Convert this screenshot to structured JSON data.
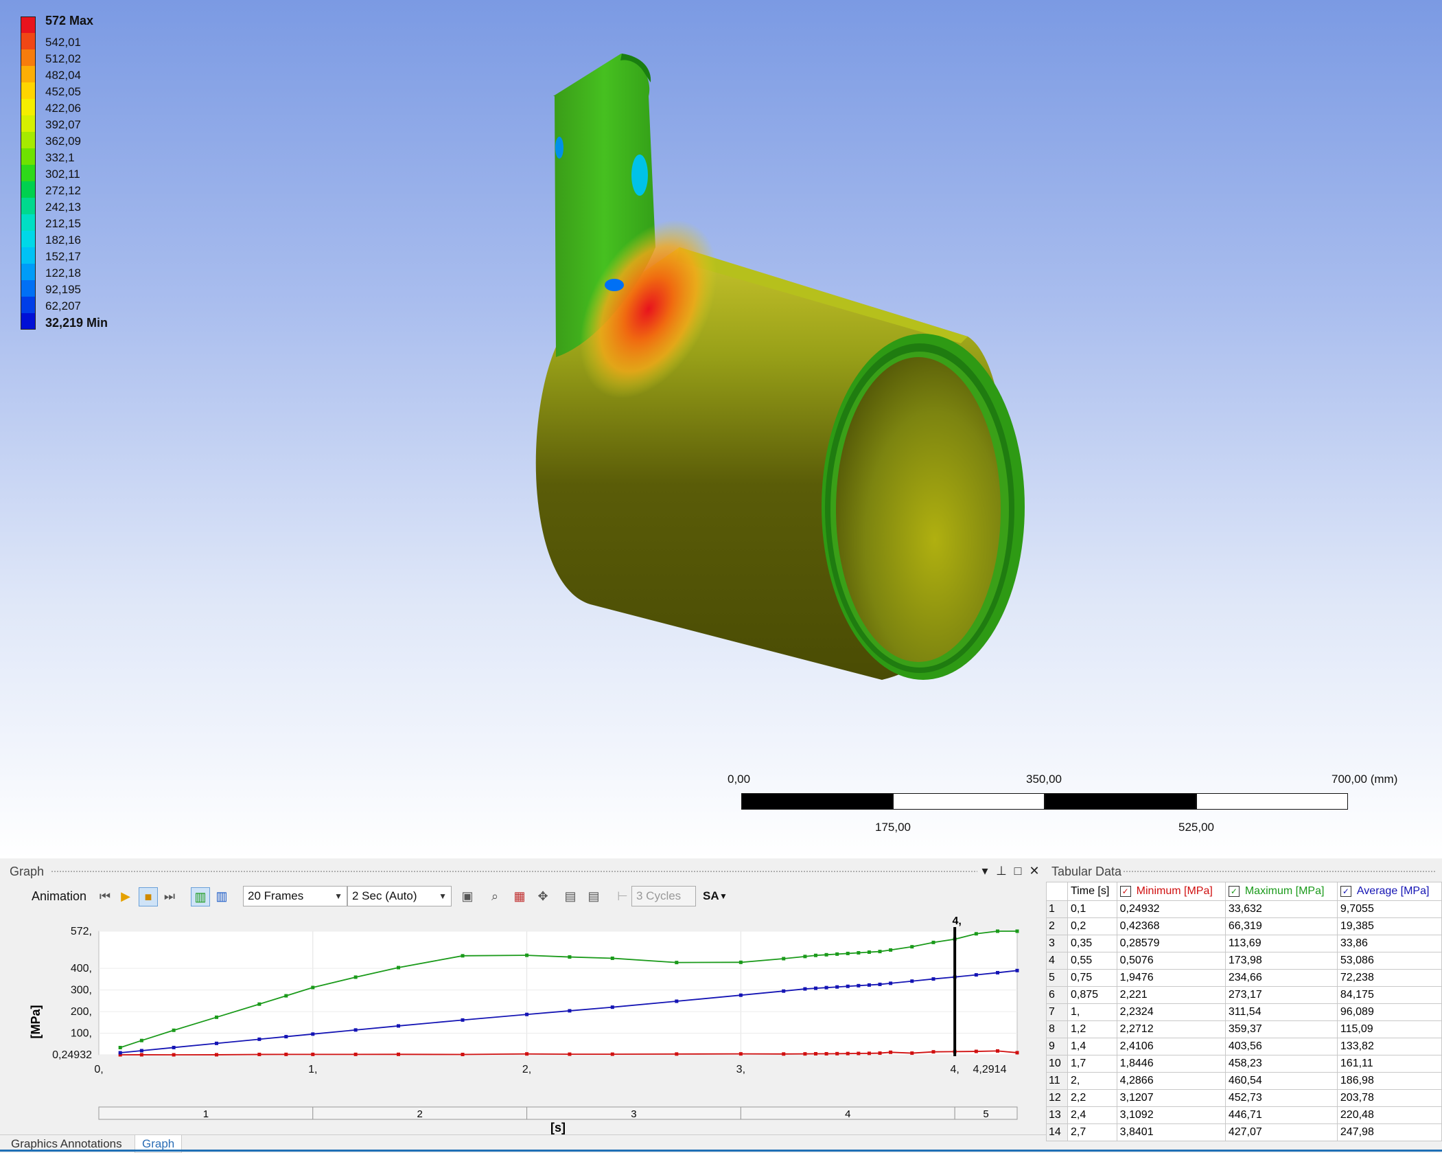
{
  "legend": {
    "entries": [
      {
        "label": "572 Max",
        "color": "#e8131d",
        "bold": true
      },
      {
        "label": "542,01",
        "color": "#f04715"
      },
      {
        "label": "512,02",
        "color": "#f77c0c"
      },
      {
        "label": "482,04",
        "color": "#fcae06"
      },
      {
        "label": "452,05",
        "color": "#ffd500"
      },
      {
        "label": "422,06",
        "color": "#f5ee00"
      },
      {
        "label": "392,07",
        "color": "#d6f000"
      },
      {
        "label": "362,09",
        "color": "#a6ea00"
      },
      {
        "label": "332,1",
        "color": "#6ee200"
      },
      {
        "label": "302,11",
        "color": "#2ed91a"
      },
      {
        "label": "272,12",
        "color": "#00d14f"
      },
      {
        "label": "242,13",
        "color": "#00d98e"
      },
      {
        "label": "212,15",
        "color": "#00dfc4"
      },
      {
        "label": "182,16",
        "color": "#00d8e8"
      },
      {
        "label": "152,17",
        "color": "#00c2f5"
      },
      {
        "label": "122,18",
        "color": "#009cf8"
      },
      {
        "label": "92,195",
        "color": "#0070f5"
      },
      {
        "label": "62,207",
        "color": "#003ee8"
      },
      {
        "label": "32,219 Min",
        "color": "#0010d6",
        "bold": true
      }
    ]
  },
  "scale_bar": {
    "top_labels": [
      "0,00",
      "350,00",
      "700,00 (mm)"
    ],
    "bottom_labels": [
      "175,00",
      "525,00"
    ]
  },
  "graph_panel": {
    "title": "Graph",
    "toolbar": {
      "animation_label": "Animation",
      "frames": "20 Frames",
      "duration": "2 Sec (Auto)",
      "cycles": "3 Cycles",
      "sa": "SA"
    }
  },
  "tabular_panel": {
    "title": "Tabular Data",
    "columns": [
      "Time [s]",
      "Minimum [MPa]",
      "Maximum [MPa]",
      "Average [MPa]"
    ],
    "rows": [
      [
        "1",
        "0,1",
        "0,24932",
        "33,632",
        "9,7055"
      ],
      [
        "2",
        "0,2",
        "0,42368",
        "66,319",
        "19,385"
      ],
      [
        "3",
        "0,35",
        "0,28579",
        "113,69",
        "33,86"
      ],
      [
        "4",
        "0,55",
        "0,5076",
        "173,98",
        "53,086"
      ],
      [
        "5",
        "0,75",
        "1,9476",
        "234,66",
        "72,238"
      ],
      [
        "6",
        "0,875",
        "2,221",
        "273,17",
        "84,175"
      ],
      [
        "7",
        "1,",
        "2,2324",
        "311,54",
        "96,089"
      ],
      [
        "8",
        "1,2",
        "2,2712",
        "359,37",
        "115,09"
      ],
      [
        "9",
        "1,4",
        "2,4106",
        "403,56",
        "133,82"
      ],
      [
        "10",
        "1,7",
        "1,8446",
        "458,23",
        "161,11"
      ],
      [
        "11",
        "2,",
        "4,2866",
        "460,54",
        "186,98"
      ],
      [
        "12",
        "2,2",
        "3,1207",
        "452,73",
        "203,78"
      ],
      [
        "13",
        "2,4",
        "3,1092",
        "446,71",
        "220,48"
      ],
      [
        "14",
        "2,7",
        "3,8401",
        "427,07",
        "247,98"
      ]
    ]
  },
  "tabs": [
    "Graphics Annotations",
    "Graph"
  ],
  "chart_data": {
    "type": "line",
    "ylabel": "[MPa]",
    "xlabel": "[s]",
    "xlim": [
      0,
      4.2914
    ],
    "ylim": [
      0.24932,
      572
    ],
    "x_ticks": [
      "0,",
      "1,",
      "2,",
      "3,",
      "4,",
      "4,2914"
    ],
    "y_ticks": [
      {
        "v": 572,
        "t": "572,"
      },
      {
        "v": 400,
        "t": "400,"
      },
      {
        "v": 300,
        "t": "300,"
      },
      {
        "v": 200,
        "t": "200,"
      },
      {
        "v": 100,
        "t": "100,"
      },
      {
        "v": 0.24932,
        "t": "0,24932"
      }
    ],
    "cursor": {
      "x": 4,
      "label": "4,"
    },
    "steps": [
      {
        "label": "1",
        "end": 1
      },
      {
        "label": "2",
        "end": 2
      },
      {
        "label": "3",
        "end": 3
      },
      {
        "label": "4",
        "end": 4
      },
      {
        "label": "5",
        "end": 4.2914
      }
    ],
    "series": [
      {
        "name": "Minimum [MPa]",
        "color": "#d01010",
        "x": [
          0.1,
          0.2,
          0.35,
          0.55,
          0.75,
          0.875,
          1,
          1.2,
          1.4,
          1.7,
          2,
          2.2,
          2.4,
          2.7,
          3,
          3.2,
          3.3,
          3.35,
          3.4,
          3.45,
          3.5,
          3.55,
          3.6,
          3.65,
          3.7,
          3.8,
          3.9,
          4,
          4.1,
          4.2,
          4.2914
        ],
        "y": [
          0.25,
          0.42,
          0.29,
          0.51,
          1.95,
          2.22,
          2.23,
          2.27,
          2.41,
          1.84,
          4.29,
          3.12,
          3.11,
          3.84,
          4.5,
          4.0,
          4.5,
          5,
          5,
          5.5,
          6,
          6.5,
          7,
          8,
          12,
          8,
          14,
          15,
          16,
          18,
          10
        ]
      },
      {
        "name": "Maximum [MPa]",
        "color": "#1a9a1a",
        "x": [
          0.1,
          0.2,
          0.35,
          0.55,
          0.75,
          0.875,
          1,
          1.2,
          1.4,
          1.7,
          2,
          2.2,
          2.4,
          2.7,
          3,
          3.2,
          3.3,
          3.35,
          3.4,
          3.45,
          3.5,
          3.55,
          3.6,
          3.65,
          3.7,
          3.8,
          3.9,
          4,
          4.1,
          4.2,
          4.2914
        ],
        "y": [
          33.63,
          66.32,
          113.69,
          173.98,
          234.66,
          273.17,
          311.54,
          359.37,
          403.56,
          458.23,
          460.54,
          452.73,
          446.71,
          427.07,
          428,
          445,
          455,
          460,
          463,
          466,
          469,
          472,
          475,
          478,
          485,
          500,
          520,
          535,
          560,
          572,
          572
        ]
      },
      {
        "name": "Average [MPa]",
        "color": "#1414b4",
        "x": [
          0.1,
          0.2,
          0.35,
          0.55,
          0.75,
          0.875,
          1,
          1.2,
          1.4,
          1.7,
          2,
          2.2,
          2.4,
          2.7,
          3,
          3.2,
          3.3,
          3.35,
          3.4,
          3.45,
          3.5,
          3.55,
          3.6,
          3.65,
          3.7,
          3.8,
          3.9,
          4,
          4.1,
          4.2,
          4.2914
        ],
        "y": [
          9.71,
          19.39,
          33.86,
          53.09,
          72.24,
          84.18,
          96.09,
          115.09,
          133.82,
          161.11,
          186.98,
          203.78,
          220.48,
          247.98,
          276,
          295,
          305,
          308,
          311,
          314,
          317,
          320,
          323,
          326,
          331,
          341,
          351,
          360,
          370,
          380,
          390
        ]
      }
    ]
  }
}
